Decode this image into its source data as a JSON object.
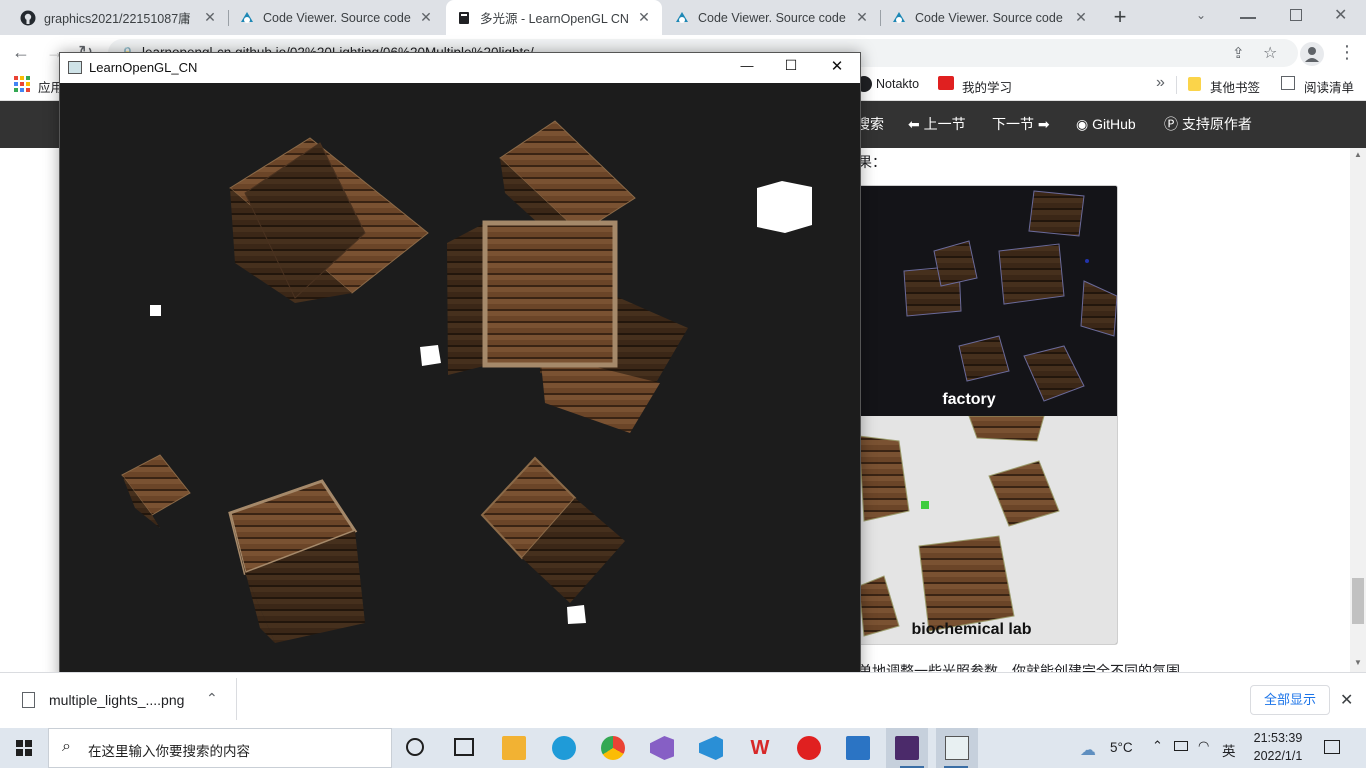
{
  "browser": {
    "tabs": [
      {
        "title": "graphics2021/22151087庸",
        "icon": "github-icon",
        "active": false
      },
      {
        "title": "Code Viewer. Source code",
        "icon": "code-viewer-icon",
        "active": false
      },
      {
        "title": "多光源 - LearnOpenGL CN",
        "icon": "book-icon",
        "active": true
      },
      {
        "title": "Code Viewer. Source code",
        "icon": "code-viewer-icon",
        "active": false
      },
      {
        "title": "Code Viewer. Source code",
        "icon": "code-viewer-icon",
        "active": false
      }
    ],
    "new_tab": "+",
    "url": "learnopengl-cn.github.io/02%20Lighting/06%20Multiple%20lights/",
    "bookmarks_left": "应用",
    "bookmarks": [
      "Notakto",
      "我的学习"
    ],
    "more_bookmarks": "»",
    "other_bookmarks": "其他书签",
    "reading_list": "阅读清单"
  },
  "site_nav": {
    "search": "搜索",
    "prev": "上一节",
    "next": "下一节",
    "github": "GitHub",
    "support": "支持原作者"
  },
  "page": {
    "text_fragment": "果：",
    "bottom_text": "单地调整一些光照参数，你就能创建完全不同的氛围。",
    "captions": [
      "factory",
      "biochemical lab"
    ]
  },
  "gl_window": {
    "title": "LearnOpenGL_CN",
    "minimize": "—",
    "maximize": "☐",
    "close": "✕"
  },
  "download_shelf": {
    "filename": "multiple_lights_....png",
    "show_all": "全部显示"
  },
  "taskbar": {
    "search_placeholder": "在这里输入你要搜索的内容",
    "weather": "5°C",
    "ime": "英",
    "time": "21:53:39",
    "date": "2022/1/1"
  }
}
